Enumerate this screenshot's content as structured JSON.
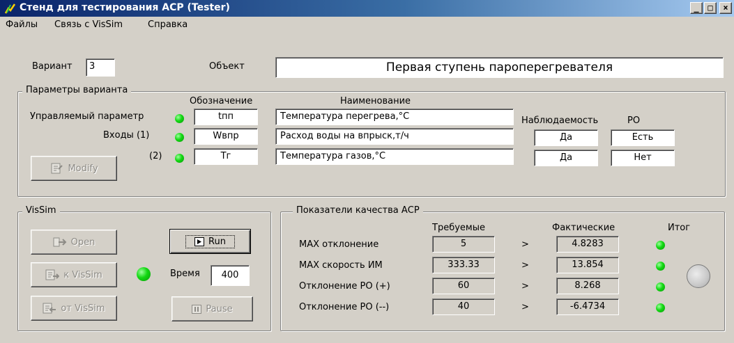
{
  "window": {
    "title": "Стенд для тестирования АСР  (Tester)",
    "controls": {
      "minimize": "_",
      "maximize": "□",
      "close": "×"
    }
  },
  "menu": [
    "Файлы",
    "Связь с VisSim",
    "Справка"
  ],
  "top": {
    "variant_label": "Вариант",
    "variant_value": "3",
    "object_label": "Объект",
    "object_value": "Первая ступень пароперегревателя"
  },
  "params": {
    "group_title": "Параметры варианта",
    "col_designation": "Обозначение",
    "col_name": "Наименование",
    "col_observability": "Наблюдаемость",
    "col_ro": "РО",
    "rows": [
      {
        "label": "Управляемый параметр",
        "designation": "tпп",
        "name": "Температура перегрева,°С",
        "observability": "",
        "ro": ""
      },
      {
        "label": "Входы  (1)",
        "designation": "Wвпр",
        "name": "Расход воды на впрыск,т/ч",
        "observability": "Да",
        "ro": "Есть"
      },
      {
        "label": "(2)",
        "designation": "Tг",
        "name": "Температура газов,°С",
        "observability": "Да",
        "ro": "Нет"
      }
    ],
    "modify_label": "Modify"
  },
  "vissim": {
    "group_title": "VisSim",
    "open_label": "Open",
    "to_vissim_label": "к VisSim",
    "from_vissim_label": "от VisSim",
    "run_label": "Run",
    "pause_label": "Pause",
    "time_label": "Время",
    "time_value": "400"
  },
  "quality": {
    "group_title": "Показатели качества АСР",
    "col_required": "Требуемые",
    "col_actual": "Фактические",
    "col_result": "Итог",
    "rows": [
      {
        "label": "МАХ отклонение",
        "required": "5",
        "op": ">",
        "actual": "4.8283"
      },
      {
        "label": "МАХ скорость ИМ",
        "required": "333.33",
        "op": ">",
        "actual": "13.854"
      },
      {
        "label": "Отклонение РО (+)",
        "required": "60",
        "op": ">",
        "actual": "8.268"
      },
      {
        "label": "Отклонение РО (--)",
        "required": "40",
        "op": ">",
        "actual": "-6.4734"
      }
    ]
  },
  "colors": {
    "led_green": "#12d812",
    "title_bar": "#0a246a",
    "face": "#d4d0c8"
  }
}
